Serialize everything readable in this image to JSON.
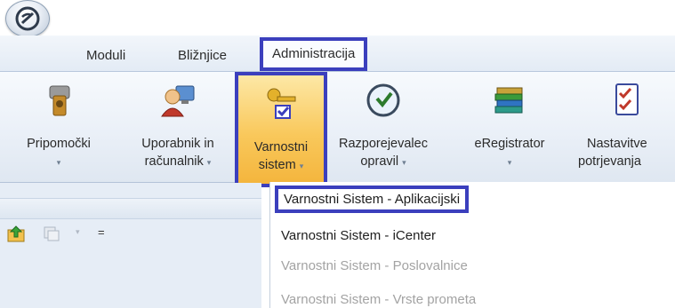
{
  "menu": {
    "tabs": [
      {
        "label": "Moduli"
      },
      {
        "label": "Bližnjice"
      },
      {
        "label": "Administracija"
      }
    ]
  },
  "ribbon": {
    "buttons": [
      {
        "line1": "Pripomočki",
        "line2": "",
        "icon": "tool-icon"
      },
      {
        "line1": "Uporabnik in",
        "line2": "računalnik",
        "icon": "user-computer-icon"
      },
      {
        "line1": "Varnostni",
        "line2": "sistem",
        "icon": "keys-check-icon"
      },
      {
        "line1": "Razporejevalec",
        "line2": "opravil",
        "icon": "scheduler-clock-icon"
      },
      {
        "line1": "eRegistrator",
        "line2": "",
        "icon": "books-icon"
      },
      {
        "line1": "Nastavitve",
        "line2": "potrjevanja",
        "icon": "checklist-icon"
      }
    ],
    "caret": "▾"
  },
  "dropdown": {
    "items": [
      {
        "label": "Varnostni Sistem - Aplikacijski",
        "enabled": true
      },
      {
        "label": "Varnostni Sistem - iCenter",
        "enabled": true
      },
      {
        "label": "Varnostni Sistem - Poslovalnice",
        "enabled": false
      },
      {
        "label": "Varnostni Sistem - Vrste prometa",
        "enabled": false
      }
    ]
  },
  "left_toolbar": {
    "icons": [
      "folder-up-icon",
      "copy-icon",
      "dropdown-arrow-icon",
      "more-icon"
    ],
    "more_glyph": "="
  },
  "colors": {
    "highlight_border": "#3b3fbd",
    "selected_button": "#f9c85b"
  }
}
